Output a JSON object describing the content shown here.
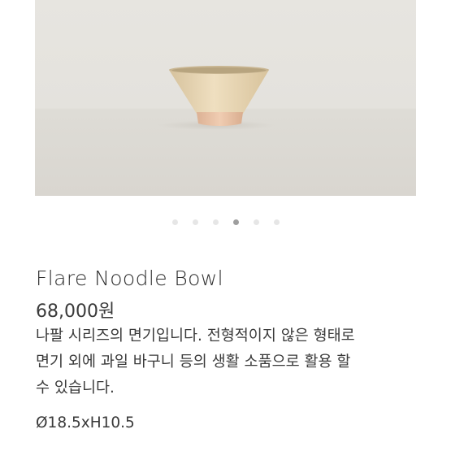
{
  "carousel": {
    "slide_count": 6,
    "active_index": 3
  },
  "product": {
    "name": "Flare Noodle Bowl",
    "price": "68,000원",
    "description_lines": [
      "나팔 시리즈의 면기입니다. 전형적이지 않은 형태로",
      "면기 외에 과일 바구니 등의 생활 소품으로 활용 할",
      "수 있습니다."
    ],
    "dimensions": "Ø18.5xH10.5"
  },
  "colors": {
    "text": "#3a3a3a",
    "dot_active": "#9e9e9e",
    "dot_inactive": "#e6e6e6"
  }
}
